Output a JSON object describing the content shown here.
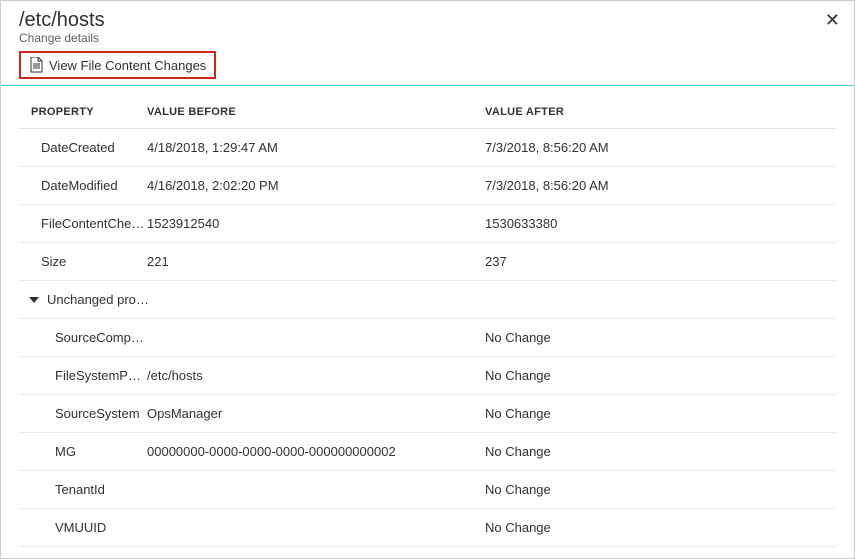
{
  "header": {
    "title": "/etc/hosts",
    "subtitle": "Change details"
  },
  "toolbar": {
    "view_changes_label": "View File Content Changes"
  },
  "table": {
    "columns": {
      "property": "PROPERTY",
      "before": "VALUE BEFORE",
      "after": "VALUE AFTER"
    },
    "changed_rows": [
      {
        "property": "DateCreated",
        "before": "4/18/2018, 1:29:47 AM",
        "after": "7/3/2018, 8:56:20 AM"
      },
      {
        "property": "DateModified",
        "before": "4/16/2018, 2:02:20 PM",
        "after": "7/3/2018, 8:56:20 AM"
      },
      {
        "property": "FileContentCheck...",
        "before": "1523912540",
        "after": "1530633380"
      },
      {
        "property": "Size",
        "before": "221",
        "after": "237"
      }
    ],
    "unchanged_section": {
      "label": "Unchanged prope...",
      "rows": [
        {
          "property": "SourceComput...",
          "before": "",
          "after": "No Change"
        },
        {
          "property": "FileSystemPath",
          "before": "/etc/hosts",
          "after": "No Change"
        },
        {
          "property": "SourceSystem",
          "before": "OpsManager",
          "after": "No Change"
        },
        {
          "property": "MG",
          "before": "00000000-0000-0000-0000-000000000002",
          "after": "No Change"
        },
        {
          "property": "TenantId",
          "before": "",
          "after": "No Change"
        },
        {
          "property": "VMUUID",
          "before": "",
          "after": "No Change"
        }
      ]
    }
  }
}
